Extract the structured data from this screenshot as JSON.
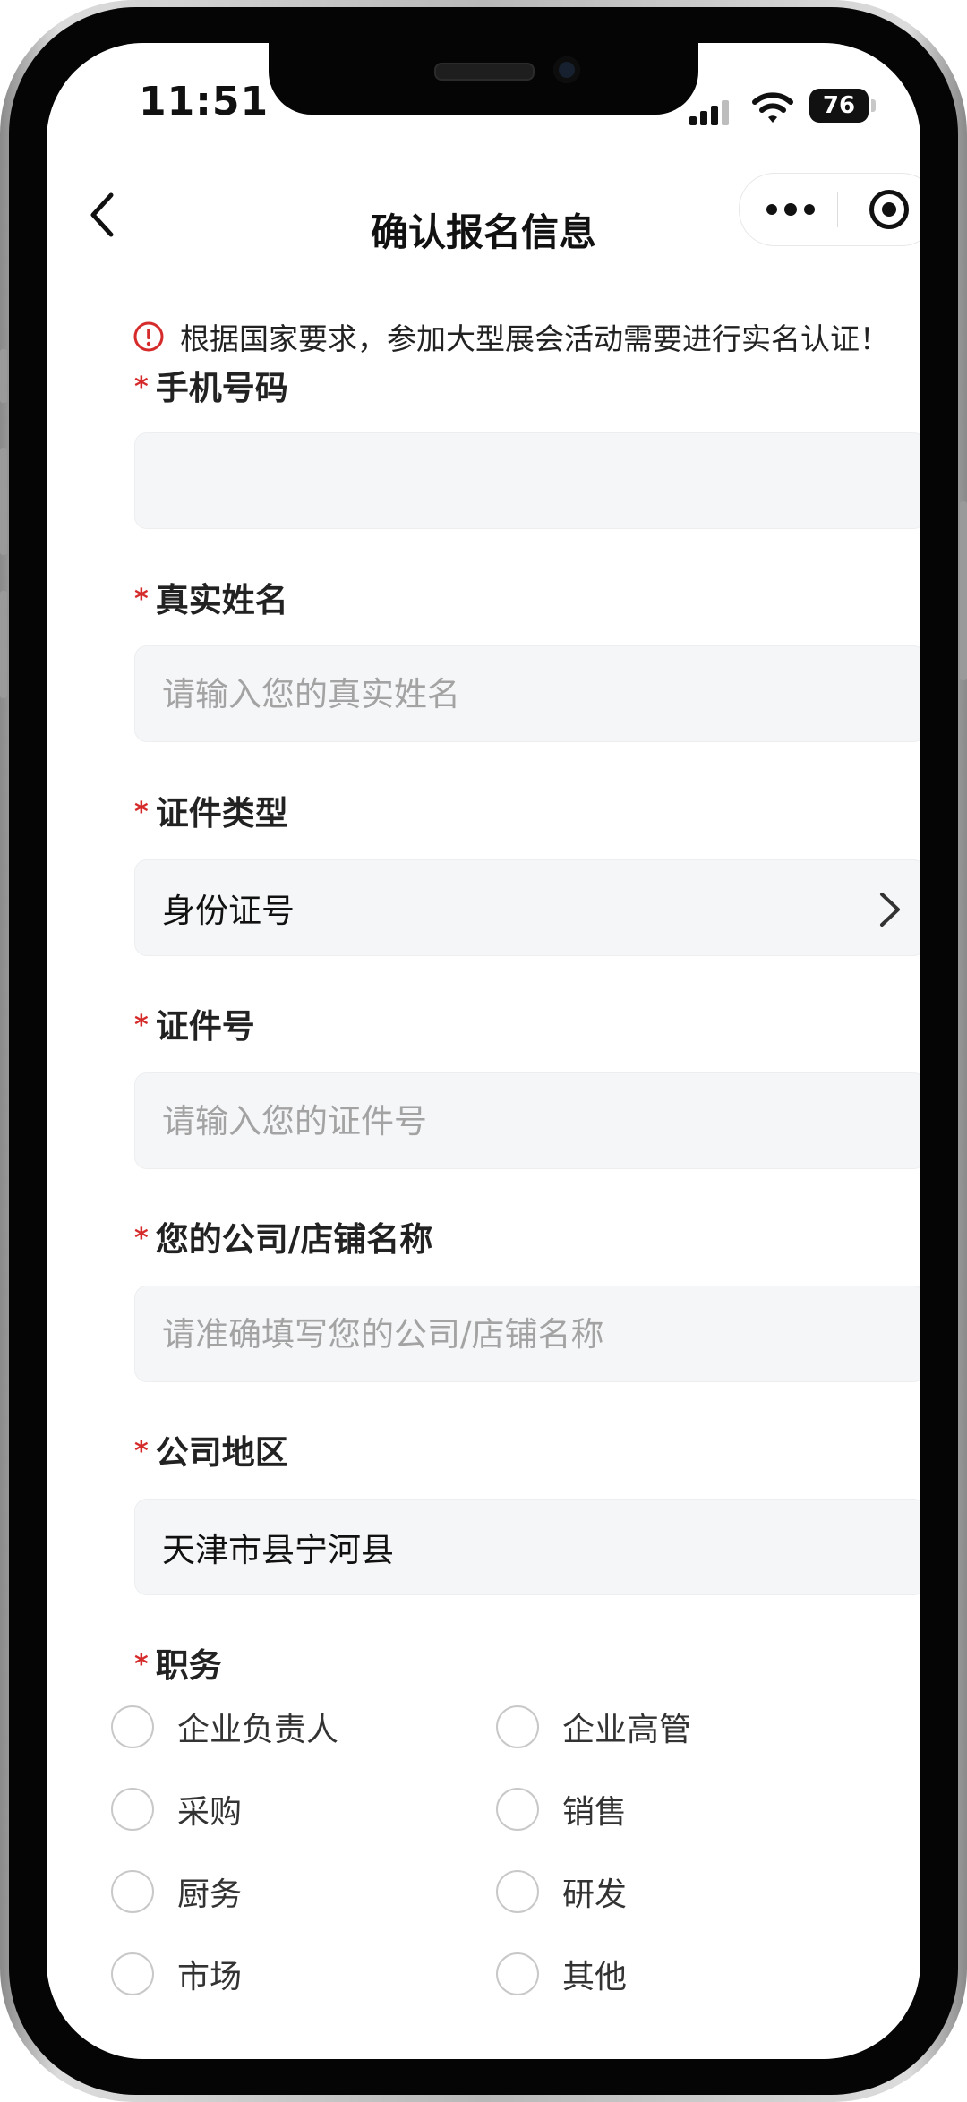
{
  "status_bar": {
    "time": "11:51",
    "battery": "76"
  },
  "nav": {
    "title": "确认报名信息"
  },
  "notice": {
    "text": "根据国家要求，参加大型展会活动需要进行实名认证！"
  },
  "form": {
    "phone": {
      "label": "手机号码",
      "value": ""
    },
    "real_name": {
      "label": "真实姓名",
      "placeholder": "请输入您的真实姓名"
    },
    "id_type": {
      "label": "证件类型",
      "value": "身份证号"
    },
    "id_number": {
      "label": "证件号",
      "placeholder": "请输入您的证件号"
    },
    "company": {
      "label": "您的公司/店铺名称",
      "placeholder": "请准确填写您的公司/店铺名称"
    },
    "region": {
      "label": "公司地区",
      "value": "天津市县宁河县"
    },
    "position": {
      "label": "职务",
      "options": [
        "企业负责人",
        "企业高管",
        "采购",
        "销售",
        "厨务",
        "研发",
        "市场",
        "其他"
      ]
    }
  },
  "colors": {
    "required_star": "#d62b2b",
    "field_bg": "#f5f6f8",
    "placeholder": "#a3a3a3"
  }
}
